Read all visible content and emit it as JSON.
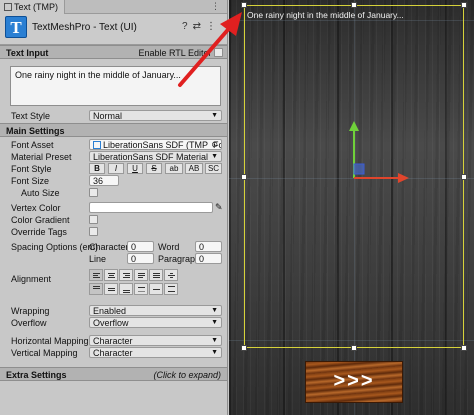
{
  "window": {
    "tab_title": "Text (TMP)"
  },
  "component": {
    "title": "TextMeshPro - Text (UI)",
    "logo_letter": "T"
  },
  "text_input": {
    "section_label": "Text Input",
    "rtl_label": "Enable RTL Editor",
    "value": "One rainy night in the middle of January...",
    "text_style_label": "Text Style",
    "text_style_value": "Normal"
  },
  "main_settings": {
    "section_label": "Main Settings",
    "font_asset_label": "Font Asset",
    "font_asset_value": "LiberationSans SDF (TMP_Font",
    "material_preset_label": "Material Preset",
    "material_preset_value": "LiberationSans SDF Material",
    "font_style_label": "Font Style",
    "font_style_buttons": [
      "B",
      "I",
      "U",
      "S",
      "ab",
      "AB",
      "SC"
    ],
    "font_size_label": "Font Size",
    "font_size_value": "36",
    "auto_size_label": "Auto Size",
    "vertex_color_label": "Vertex Color",
    "color_gradient_label": "Color Gradient",
    "override_tags_label": "Override Tags",
    "spacing_label": "Spacing Options (em)",
    "character_label": "Character",
    "character_value": "0",
    "word_label": "Word",
    "word_value": "0",
    "line_label": "Line",
    "line_value": "0",
    "paragraph_label": "Paragraph",
    "paragraph_value": "0",
    "alignment_label": "Alignment",
    "wrapping_label": "Wrapping",
    "wrapping_value": "Enabled",
    "overflow_label": "Overflow",
    "overflow_value": "Overflow",
    "horizontal_mapping_label": "Horizontal Mapping",
    "horizontal_mapping_value": "Character",
    "vertical_mapping_label": "Vertical Mapping",
    "vertical_mapping_value": "Character"
  },
  "extra_settings": {
    "section_label": "Extra Settings",
    "hint": "(Click to expand)"
  },
  "scene": {
    "text": "One rainy night in the middle of January...",
    "button_label": ">>>"
  },
  "colors": {
    "selection": "#d6d23a",
    "arrow": "#e02020",
    "tmp_blue": "#2a7fd3"
  }
}
